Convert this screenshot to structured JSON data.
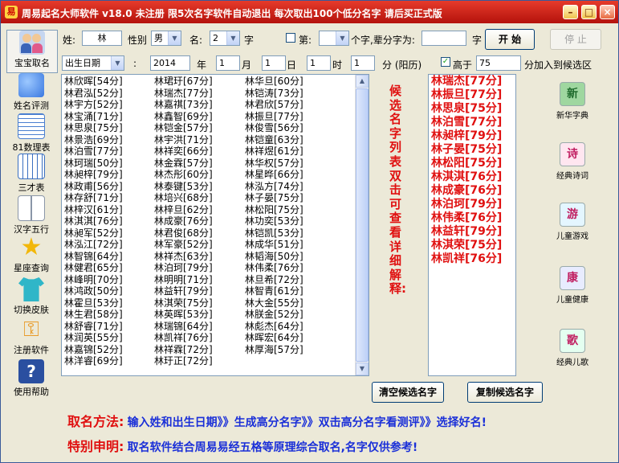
{
  "titlebar": {
    "title": "周易起名大师软件 v18.0  未注册  限5次名字软件自动退出 每次取出100个低分名字 请后买正式版",
    "min": "–",
    "max": "□",
    "close": "×"
  },
  "sidebar": {
    "items": [
      {
        "label": "宝宝取名",
        "icon": "baby-couple-icon",
        "color": "#6f8fc8"
      },
      {
        "label": "姓名评测",
        "icon": "people-icon",
        "color": "#4d8ee8"
      },
      {
        "label": "81数理表",
        "icon": "table-icon",
        "color": "#4a7fd0"
      },
      {
        "label": "三才表",
        "icon": "grid-icon",
        "color": "#3a6fc0"
      },
      {
        "label": "汉字五行",
        "icon": "book-icon",
        "color": "#8a96a8"
      },
      {
        "label": "星座查询",
        "icon": "star-icon",
        "color": "#f2b70a"
      },
      {
        "label": "切换皮肤",
        "icon": "tshirt-icon",
        "color": "#2fb6c8"
      },
      {
        "label": "注册软件",
        "icon": "key-icon",
        "color": "#e89a28"
      },
      {
        "label": "使用帮助",
        "icon": "help-icon",
        "color": "#2a4fa0"
      }
    ]
  },
  "form": {
    "surname_label": "姓:",
    "surname_value": "林",
    "gender_label": "性别",
    "gender_value": "男",
    "ming_label": "名:",
    "ming_value": "2",
    "zi_label": "字",
    "di_label": "第:",
    "zi_pos_label": "个字,辈分字为:",
    "zi2_label": "字",
    "start_button": "开  始",
    "stop_button": "停  止",
    "date_type": "出生日期",
    "colon": ":",
    "year": "2014",
    "year_label": "年",
    "month": "1",
    "month_label": "月",
    "day": "1",
    "day_label": "日",
    "hour": "1",
    "hour_label": "时",
    "minute": "1",
    "minute_label": "分 (阳历)",
    "gt_label": "高于",
    "gt_value": "75",
    "gt_suffix": "分加入到候选区",
    "check_mark": "✓",
    "dropdown_arrow": "▼"
  },
  "name_list": {
    "col1": [
      "林欣晖[54分]",
      "林君泓[52分]",
      "林宇方[52分]",
      "林宝涌[71分]",
      "林思泉[75分]",
      "林景浩[69分]",
      "林泊雪[77分]",
      "林珂瑞[50分]",
      "林昶梓[79分]",
      "林政甫[56分]",
      "林存舒[71分]",
      "林梓汉[61分]",
      "林淇淇[76分]",
      "林昶军[52分]",
      "林泓江[72分]",
      "林智锦[64分]",
      "林健君[65分]",
      "林峰明[70分]",
      "林鸿政[50分]",
      "林霍旦[53分]",
      "林生君[58分]",
      "林舒睿[71分]",
      "林润英[55分]",
      "林嘉锦[52分]",
      "林洋睿[69分]"
    ],
    "col2": [
      "林珺玗[67分]",
      "林瑞杰[77分]",
      "林嘉祺[73分]",
      "林鑫智[69分]",
      "林铠金[57分]",
      "林宇洪[71分]",
      "林祥奕[66分]",
      "林金霖[57分]",
      "林杰彤[60分]",
      "林泰键[53分]",
      "林培兴[68分]",
      "林梓旦[62分]",
      "林成豪[76分]",
      "林君俊[68分]",
      "林军豪[52分]",
      "林祥杰[63分]",
      "林泊珂[79分]",
      "林明明[71分]",
      "林益轩[79分]",
      "林淇荣[75分]",
      "林英晖[53分]",
      "林瑞锦[64分]",
      "林凯祥[76分]",
      "林祥霖[72分]",
      "林玗正[72分]"
    ],
    "col3": [
      "林华旦[60分]",
      "林铠涛[73分]",
      "林君欣[57分]",
      "林振旦[77分]",
      "林俊雪[56分]",
      "林铠童[63分]",
      "林祥煜[61分]",
      "林华权[57分]",
      "林星晔[66分]",
      "林泓方[74分]",
      "林子晏[75分]",
      "林松阳[75分]",
      "林功奕[53分]",
      "林铠凯[53分]",
      "林成华[51分]",
      "林韬海[50分]",
      "林伟柔[76分]",
      "林旦希[72分]",
      "林智青[61分]",
      "林大金[55分]",
      "林朕金[52分]",
      "林彪杰[64分]",
      "林晖宏[64分]",
      "林厚海[57分]"
    ]
  },
  "vertical_label": "候选名字列表双击可查看详细解释:",
  "candidates": [
    "林瑞杰[77分]",
    "林振旦[77分]",
    "林思泉[75分]",
    "林泊雪[77分]",
    "林昶梓[79分]",
    "林子晏[75分]",
    "林松阳[75分]",
    "林淇淇[76分]",
    "林成豪[76分]",
    "林泊珂[79分]",
    "林伟柔[76分]",
    "林益轩[79分]",
    "林淇荣[75分]",
    "林凯祥[76分]"
  ],
  "buttons": {
    "clear": "清空候选名字",
    "copy": "复制候选名字"
  },
  "tools": [
    {
      "label": "新华字典",
      "glyph": "新",
      "color": "#1f6b2d",
      "bg": "#9fd7a0"
    },
    {
      "label": "经典诗词",
      "glyph": "诗",
      "color": "#c01d60",
      "bg": "#ffe6f0"
    },
    {
      "label": "儿童游戏",
      "glyph": "游",
      "color": "#c01d60",
      "bg": "#e4f6ff"
    },
    {
      "label": "儿童健康",
      "glyph": "康",
      "color": "#c01d60",
      "bg": "#e8ecff"
    },
    {
      "label": "经典儿歌",
      "glyph": "歌",
      "color": "#c01d60",
      "bg": "#e4fff0"
    }
  ],
  "footer": {
    "method_head": "取名方法:",
    "method_text": "输入姓和出生日期》》生成高分名字》》双击高分名字看测评》》选择好名!",
    "notice_head": "特别申明:",
    "notice_text": "取名软件结合周易易经五格等原理综合取名,名字仅供参考!"
  },
  "colors": {
    "titlebar": "#c8170f",
    "accent_red": "#e01010",
    "accent_blue": "#1a2fd8",
    "window_bg": "#ece9d8"
  }
}
